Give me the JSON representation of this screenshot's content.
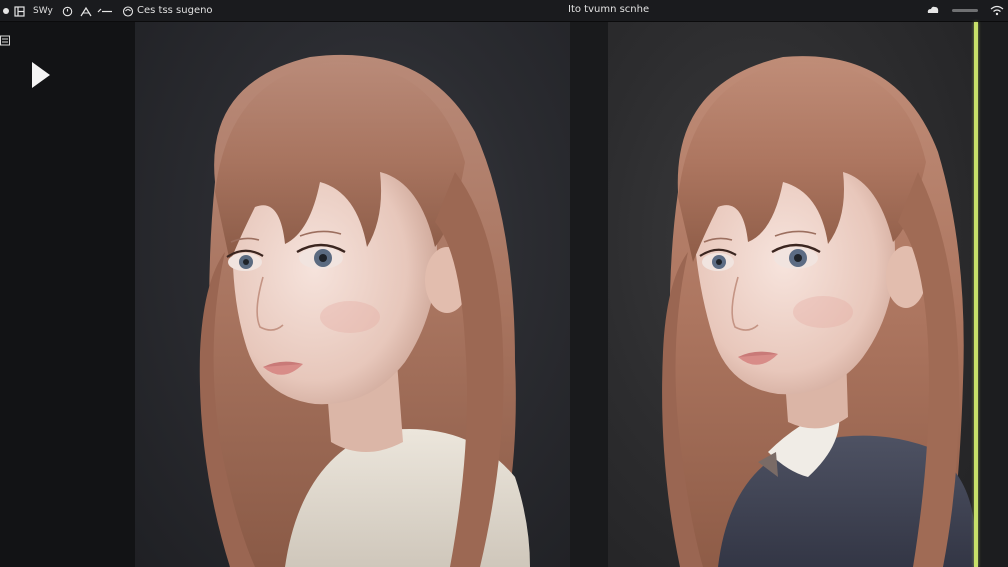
{
  "toolbar": {
    "left_items": [
      {
        "icon": "circle-dot-icon"
      },
      {
        "icon": "layout-icon"
      },
      {
        "text": "SWy"
      },
      {
        "icon": "clock-icon"
      },
      {
        "icon": "pen-icon"
      },
      {
        "icon": "arrow-icon"
      },
      {
        "icon": "eye-icon"
      },
      {
        "text": "Ces tss sugeno"
      }
    ],
    "center_title": "Ito tvumn scnhe"
  },
  "sidebar": {
    "menu_icon": "menu-icon",
    "play_icon": "play-icon"
  },
  "viewers": {
    "left": {
      "name": "source-view"
    },
    "right": {
      "name": "output-view"
    }
  },
  "colors": {
    "compare_line": "#c8e06a",
    "background": "#141517",
    "toolbar": "#1a1b1e"
  }
}
